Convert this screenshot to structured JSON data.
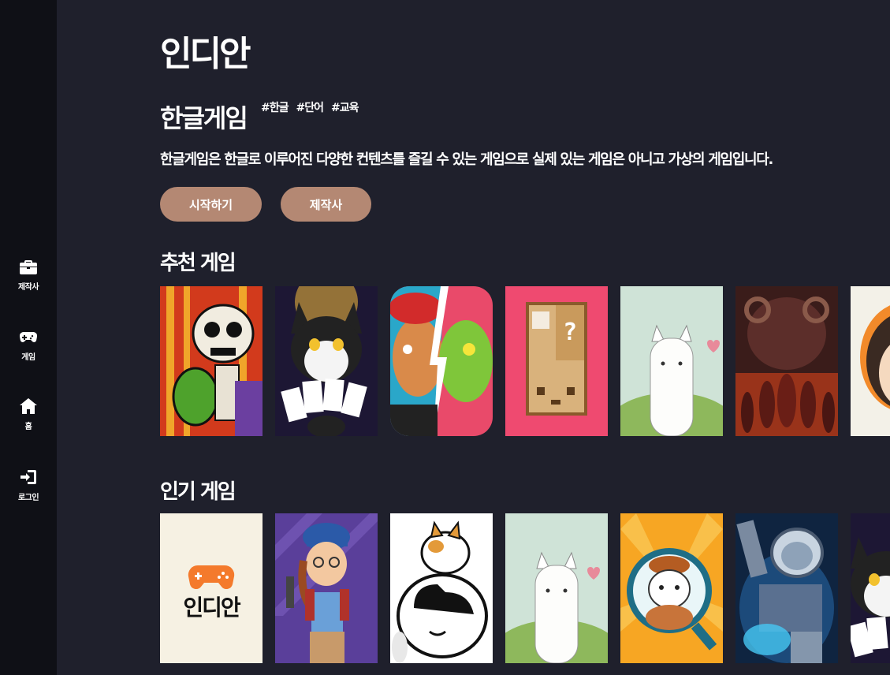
{
  "sidebar": {
    "items": [
      {
        "label": "제작사",
        "icon": "briefcase-icon"
      },
      {
        "label": "게임",
        "icon": "gamepad-icon"
      },
      {
        "label": "홈",
        "icon": "home-icon"
      },
      {
        "label": "로그인",
        "icon": "login-icon"
      }
    ]
  },
  "header": {
    "brand": "인디안"
  },
  "game": {
    "title": "한글게임",
    "tags": [
      "#한글",
      "#단어",
      "#교육"
    ],
    "description": "한글게임은 한글로 이루어진 다양한 컨텐츠를 즐길 수 있는 게임으로 실제 있는 게임은 아니고 가상의 게임입니다.",
    "start_label": "시작하기",
    "maker_label": "제작사"
  },
  "sections": {
    "recommended_title": "추천 게임",
    "popular_title": "인기 게임"
  },
  "placeholder_logo_text": "인디안",
  "colors": {
    "background": "#1f202c",
    "sidebar": "#0f1016",
    "accent_button": "#b48873",
    "logo_orange": "#f47a2c"
  }
}
